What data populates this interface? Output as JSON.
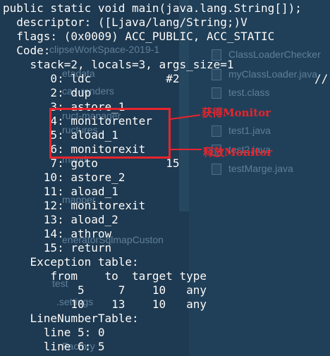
{
  "ide_background": {
    "files": [
      "ClassLoaderChecker",
      "myClassLoader.java",
      "test.class",
      "test1.java",
      "test2.java",
      "testMarge.java"
    ],
    "tree": [
      "clipseWorkSpace-2019-1",
      "etadata",
      "cas-renders",
      "ruct-manager",
      "ructures",
      "mand",
      "mapper",
      "eneratorSqlmapCuston",
      "test",
      ".settings",
      "Factory"
    ]
  },
  "code_lines": [
    "public static void main(java.lang.String[]);",
    "  descriptor: ([Ljava/lang/String;)V",
    "  flags: (0x0009) ACC_PUBLIC, ACC_STATIC",
    "  Code:",
    "    stack=2, locals=3, args_size=1",
    "       0: ldc           #2",
    "       2: dup",
    "       3: astore_1",
    "       4: monitorenter",
    "       5: aload_1",
    "       6: monitorexit",
    "       7: goto          15",
    "      10: astore_2",
    "      11: aload_1",
    "      12: monitorexit",
    "      13: aload_2",
    "      14: athrow",
    "      15: return",
    "    Exception table:",
    "       from    to  target type",
    "           5     7    10   any",
    "          10    13    10   any",
    "    LineNumberTable:",
    "      line 5: 0",
    "      line 6: 5"
  ],
  "annotations": {
    "enter_label": "获得Monitor",
    "exit_label": "释放Monitor",
    "color": "#e8242c"
  },
  "extra_text": {
    "slashes": "//"
  }
}
